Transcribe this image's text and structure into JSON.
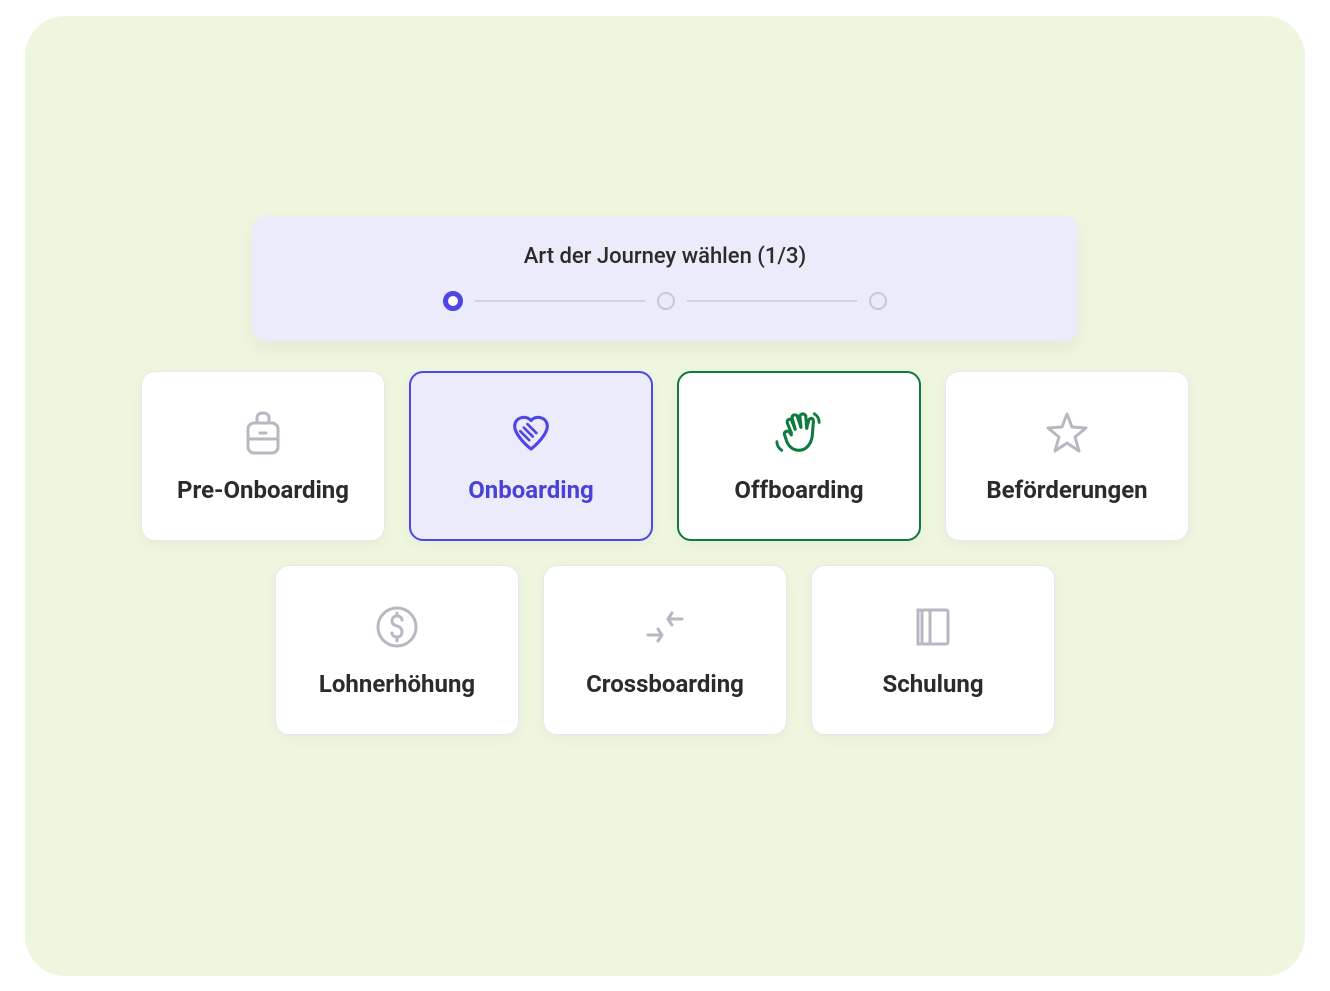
{
  "stepper": {
    "title": "Art der Journey wählen (1/3)",
    "current_step": 1,
    "total_steps": 3
  },
  "options": {
    "row1": [
      {
        "id": "pre-onboarding",
        "label": "Pre-Onboarding",
        "icon": "backpack",
        "state": "default"
      },
      {
        "id": "onboarding",
        "label": "Onboarding",
        "icon": "handshake",
        "state": "selected"
      },
      {
        "id": "offboarding",
        "label": "Offboarding",
        "icon": "wave-hand",
        "state": "green"
      },
      {
        "id": "befoerderungen",
        "label": "Beförderungen",
        "icon": "star",
        "state": "default"
      }
    ],
    "row2": [
      {
        "id": "lohnerhoehung",
        "label": "Lohnerhöhung",
        "icon": "dollar",
        "state": "default"
      },
      {
        "id": "crossboarding",
        "label": "Crossboarding",
        "icon": "arrows-cross",
        "state": "default"
      },
      {
        "id": "schulung",
        "label": "Schulung",
        "icon": "book",
        "state": "default"
      }
    ]
  },
  "colors": {
    "accent": "#4f46e5",
    "green": "#0d7a3f",
    "gray": "#b8b8c2",
    "text": "#2b2b2b",
    "card_bg": "#ffffff",
    "selected_bg": "#ecebfc",
    "page_bg": "#eff6e0"
  }
}
